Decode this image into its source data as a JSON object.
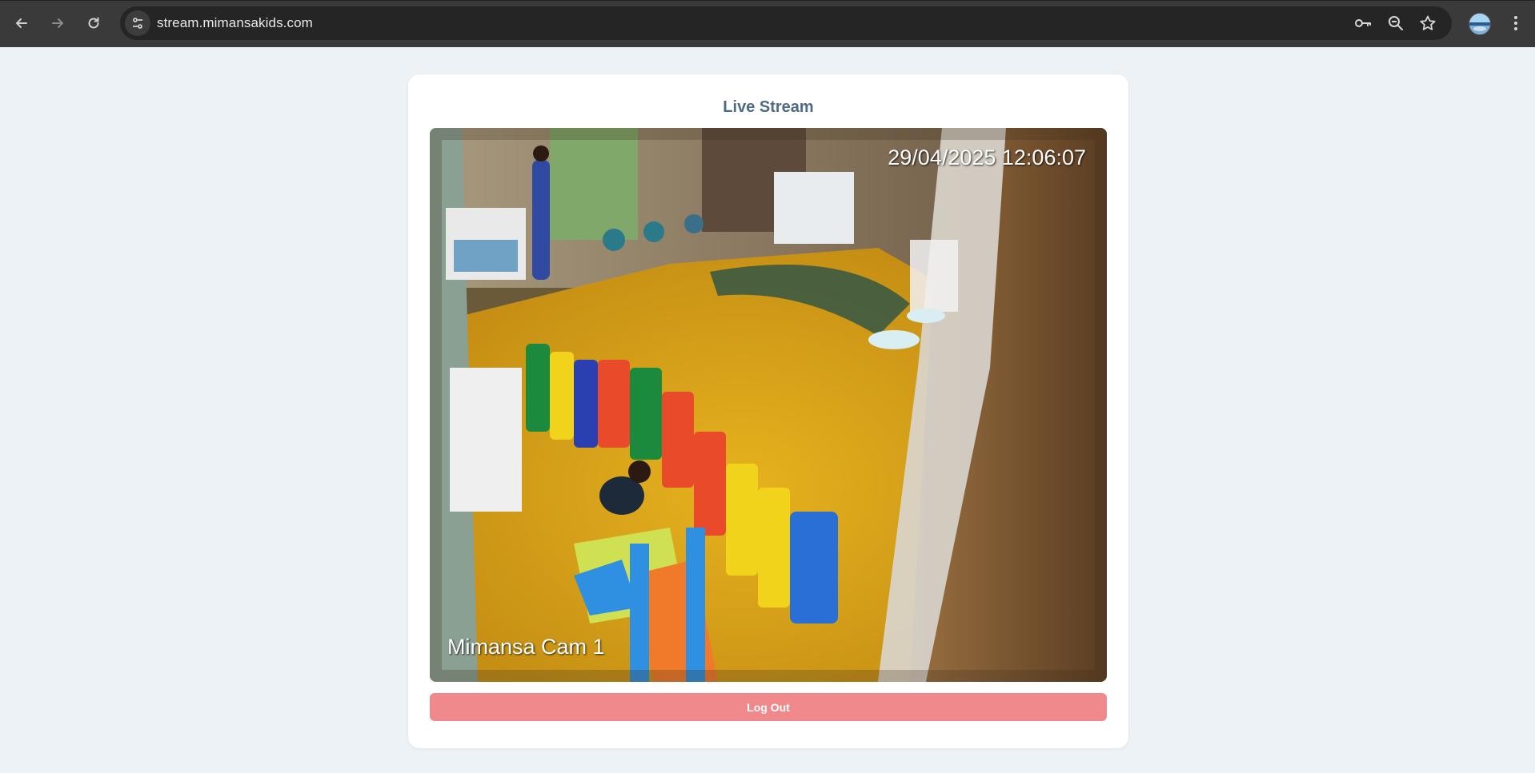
{
  "browser": {
    "url": "stream.mimansakids.com",
    "icons": {
      "back": "arrow-left-icon",
      "forward": "arrow-right-icon",
      "reload": "reload-icon",
      "site_info": "tune-icon",
      "passwords": "key-icon",
      "zoom": "zoom-out-icon",
      "bookmark": "star-icon",
      "profile": "avatar",
      "menu": "kebab-menu-icon"
    }
  },
  "page": {
    "title": "Live Stream",
    "video": {
      "timestamp": "29/04/2025 12:06:07",
      "camera_label": "Mimansa Cam 1"
    },
    "logout_label": "Log Out"
  },
  "colors": {
    "page_bg": "#edf2f6",
    "card_bg": "#ffffff",
    "title": "#4e6a86",
    "logout_bg": "#f0898c",
    "chrome_bg": "#3a3a3a",
    "omnibox_bg": "#252525"
  }
}
